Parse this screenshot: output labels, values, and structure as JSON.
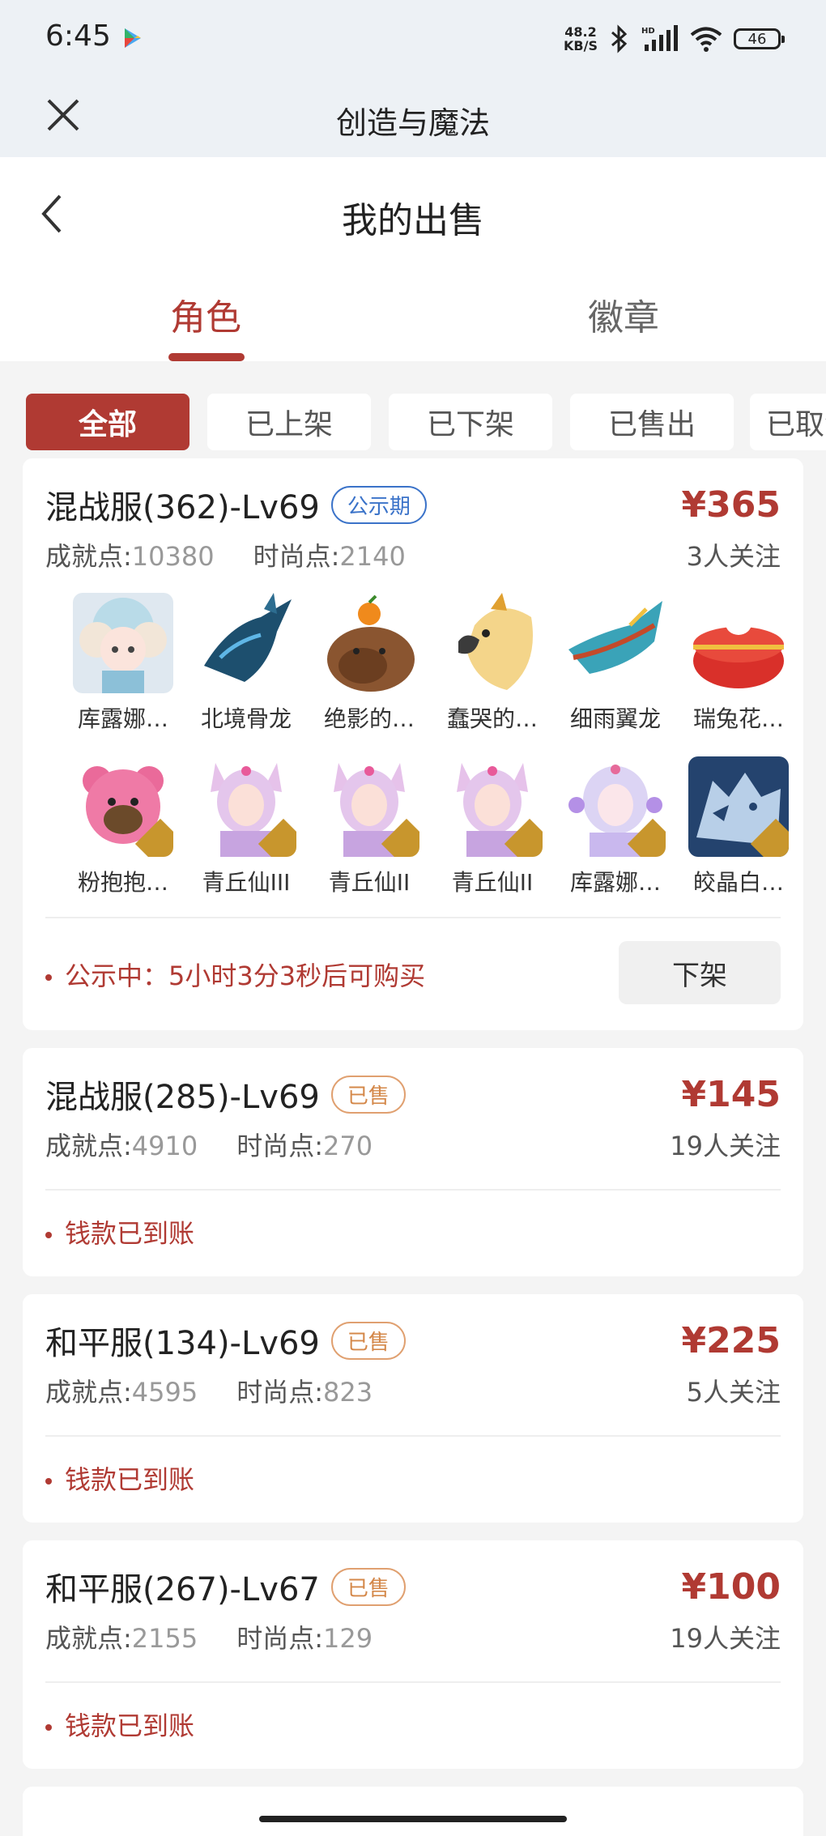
{
  "status_bar": {
    "time": "6:45",
    "net_speed_top": "48.2",
    "net_speed_bottom": "KB/S",
    "battery": "46"
  },
  "app_bar": {
    "title": "创造与魔法"
  },
  "page": {
    "title": "我的出售"
  },
  "tabs": [
    {
      "label": "角色",
      "active": true
    },
    {
      "label": "徽章",
      "active": false
    }
  ],
  "filters": [
    {
      "label": "全部",
      "active": true
    },
    {
      "label": "已上架"
    },
    {
      "label": "已下架"
    },
    {
      "label": "已售出"
    },
    {
      "label": "已取消"
    }
  ],
  "colors": {
    "accent": "#b03a33",
    "public_tag": "#3b73c9",
    "sold_tag": "#d4884a"
  },
  "listings": [
    {
      "title": "混战服(362)-Lv69",
      "status": "公示期",
      "achievement_label": "成就点:",
      "achievement": "10380",
      "fashion_label": "时尚点:",
      "fashion": "2140",
      "price": "¥365",
      "followers": "3人关注",
      "items": [
        {
          "name": "库露娜…",
          "icon": "cloud-girl"
        },
        {
          "name": "北境骨龙",
          "icon": "bone-dragon"
        },
        {
          "name": "绝影的…",
          "icon": "capybara"
        },
        {
          "name": "蠢哭的…",
          "icon": "cockatoo"
        },
        {
          "name": "细雨翼龙",
          "icon": "wing-dragon"
        },
        {
          "name": "瑞兔花…",
          "icon": "rabbit-drum"
        },
        {
          "name": "粉抱抱…",
          "icon": "pink-bear"
        },
        {
          "name": "青丘仙III",
          "icon": "fox-fairy"
        },
        {
          "name": "青丘仙II",
          "icon": "fox-fairy"
        },
        {
          "name": "青丘仙II",
          "icon": "fox-fairy"
        },
        {
          "name": "库露娜…",
          "icon": "cloud-girl"
        },
        {
          "name": "皎晶白…",
          "icon": "white-wolf"
        }
      ],
      "note": "公示中：5小时3分3秒后可购买",
      "action": "下架"
    },
    {
      "title": "混战服(285)-Lv69",
      "status": "已售",
      "achievement_label": "成就点:",
      "achievement": "4910",
      "fashion_label": "时尚点:",
      "fashion": "270",
      "price": "¥145",
      "followers": "19人关注",
      "note": "钱款已到账"
    },
    {
      "title": "和平服(134)-Lv69",
      "status": "已售",
      "achievement_label": "成就点:",
      "achievement": "4595",
      "fashion_label": "时尚点:",
      "fashion": "823",
      "price": "¥225",
      "followers": "5人关注",
      "note": "钱款已到账"
    },
    {
      "title": "和平服(267)-Lv67",
      "status": "已售",
      "achievement_label": "成就点:",
      "achievement": "2155",
      "fashion_label": "时尚点:",
      "fashion": "129",
      "price": "¥100",
      "followers": "19人关注",
      "note": "钱款已到账"
    }
  ]
}
